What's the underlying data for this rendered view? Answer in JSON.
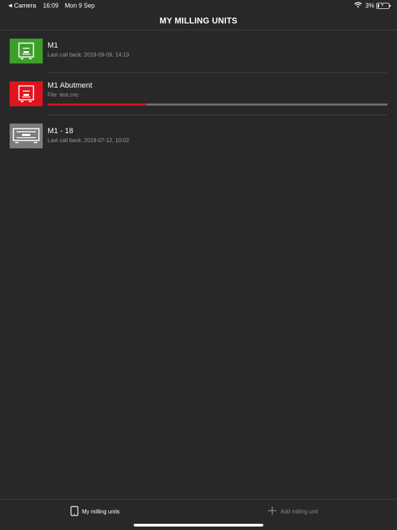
{
  "status_bar": {
    "back_glyph": "◀",
    "back_app": "Camera",
    "time": "16:09",
    "date": "Mon 9 Sep",
    "battery_percent": "3%",
    "battery_level": 0.03,
    "icons": [
      "wifi-icon",
      "battery-icon",
      "charging-bolt-icon"
    ]
  },
  "nav": {
    "title": "MY MILLING UNITS"
  },
  "units": [
    {
      "name": "M1",
      "subtitle": "Last call back: 2019-09-09, 14:19",
      "status_color": "#3e9e2a",
      "icon": "milling-machine-icon"
    },
    {
      "name": "M1 Abutment",
      "subtitle": "File: test.cnc",
      "status_color": "#e0141e",
      "icon": "milling-machine-icon",
      "progress": 0.29
    },
    {
      "name": "M1 - 18",
      "subtitle": "Last call back: 2019-07-12, 10:02",
      "status_color": "#7d7d7d",
      "icon": "milling-machine-wide-icon"
    }
  ],
  "tabs": {
    "units_label": "My milling units",
    "add_label": "Add milling unit",
    "units_icon": "tablet-icon",
    "add_icon": "plus-icon"
  },
  "colors": {
    "background": "#282828",
    "progress_track": "#6f6f6f",
    "progress_fill": "#d0161f",
    "secondary_text": "#9a9a9a"
  }
}
